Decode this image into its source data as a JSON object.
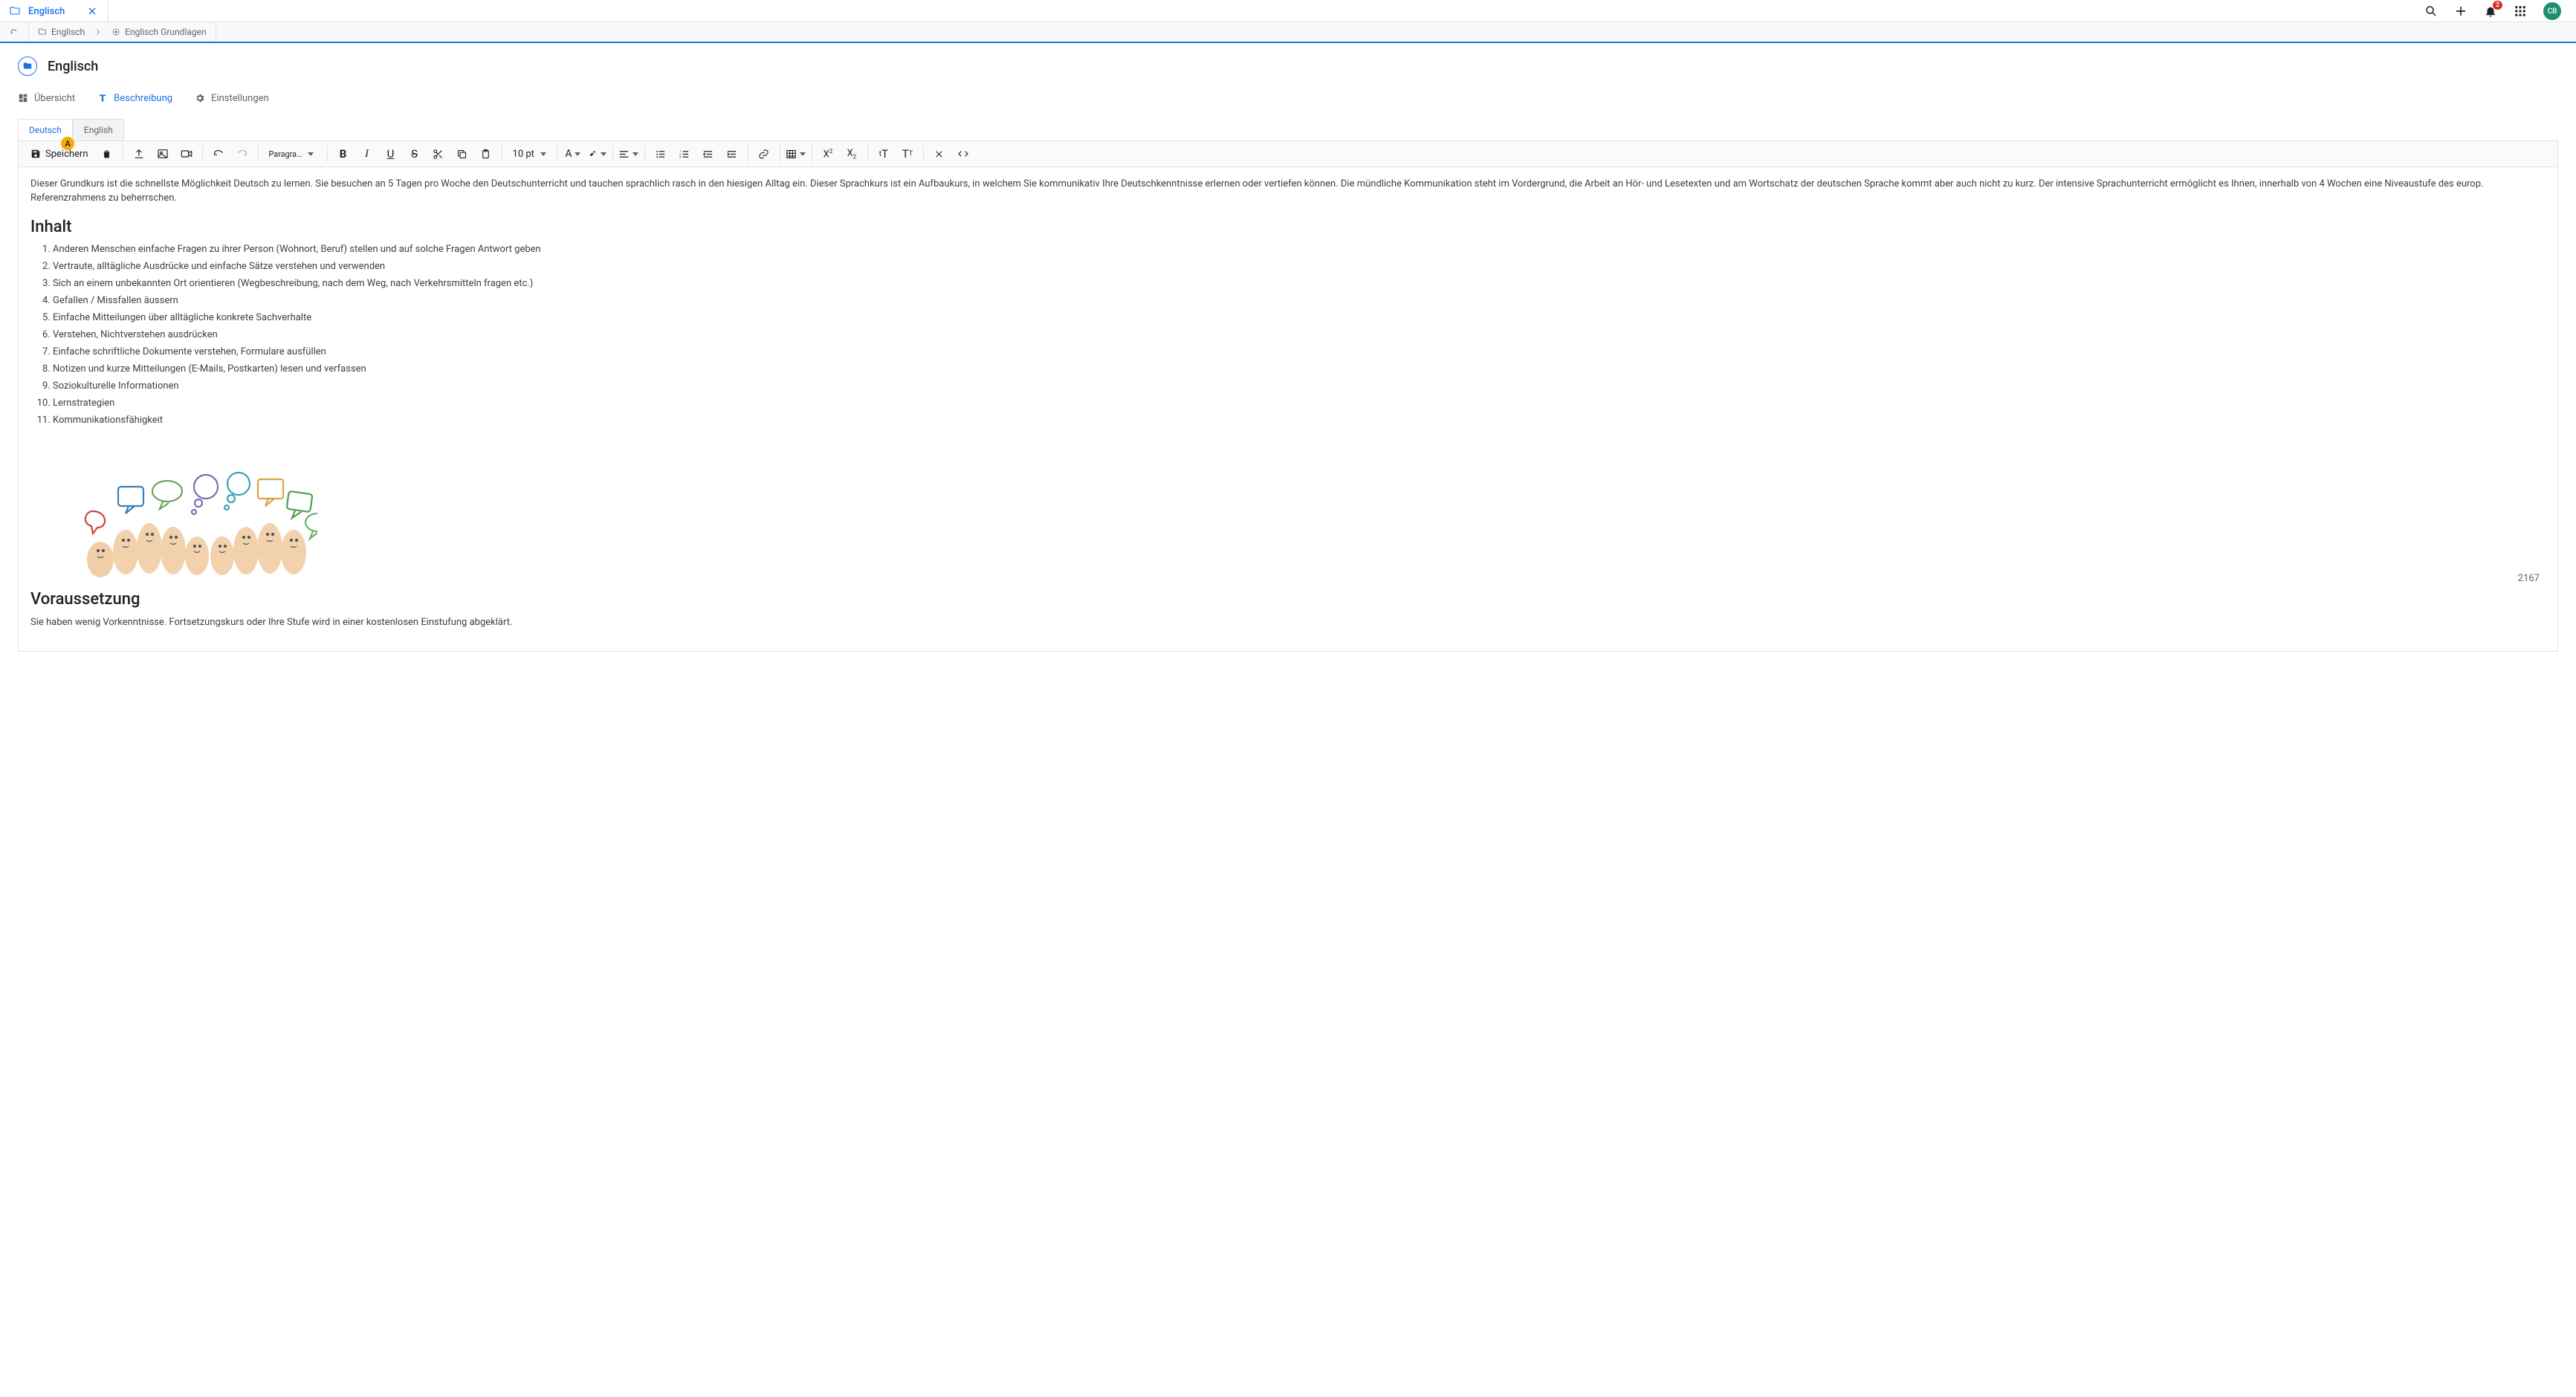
{
  "notifications_count": "2",
  "avatar_initials": "CB",
  "app_tab": {
    "label": "Englisch"
  },
  "breadcrumb": {
    "level1": "Englisch",
    "level2": "Englisch Grundlagen"
  },
  "page_title": "Englisch",
  "main_tabs": {
    "overview": "Übersicht",
    "description": "Beschreibung",
    "settings": "Einstellungen"
  },
  "lang_tabs": {
    "de": "Deutsch",
    "en": "English"
  },
  "a_badge": "A",
  "toolbar": {
    "save": "Speichern",
    "paragraph": "Paragra…",
    "font_size": "10 pt",
    "font_color_glyph": "A"
  },
  "content": {
    "intro": "Dieser Grundkurs ist die schnellste Möglichkeit Deutsch zu lernen. Sie besuchen an 5 Tagen pro Woche den Deutschunterricht und tauchen sprachlich rasch in den hiesigen Alltag ein. Dieser Sprachkurs ist ein Aufbaukurs, in welchem Sie kommunikativ Ihre Deutschkenntnisse erlernen oder vertiefen können. Die mündliche Kommunikation steht im Vordergrund, die Arbeit an Hör- und Lesetexten und am Wortschatz der deutschen Sprache kommt aber auch nicht zu kurz. Der intensive Sprachunterricht ermöglicht es Ihnen, innerhalb von 4 Wochen eine Niveaustufe des europ. Referenzrahmens zu beherrschen.",
    "h_inhalt": "Inhalt",
    "items": [
      "Anderen Menschen einfache Fragen zu ihrer Person (Wohnort, Beruf) stellen und auf solche Fragen Antwort geben",
      "Vertraute, alltägliche Ausdrücke und einfache Sätze verstehen und verwenden",
      "Sich an einem unbekannten Ort orientieren (Wegbeschreibung, nach dem Weg, nach Verkehrsmitteln fragen etc.)",
      "Gefallen / Missfallen äussern",
      "Einfache Mitteilungen über alltägliche konkrete Sachverhalte",
      "Verstehen, Nichtverstehen ausdrücken",
      "Einfache schriftliche Dokumente verstehen, Formulare ausfüllen",
      "Notizen und kurze Mitteilungen (E-Mails, Postkarten) lesen und verfassen",
      "Soziokulturelle Informationen",
      "Lernstrategien",
      "Kommunikationsfähigkeit"
    ],
    "h_voraus": "Voraussetzung",
    "voraus_text": "Sie haben wenig Vorkenntnisse. Fortsetzungskurs oder Ihre Stufe wird in einer kostenlosen Einstufung abgeklärt.",
    "char_count": "2167"
  }
}
